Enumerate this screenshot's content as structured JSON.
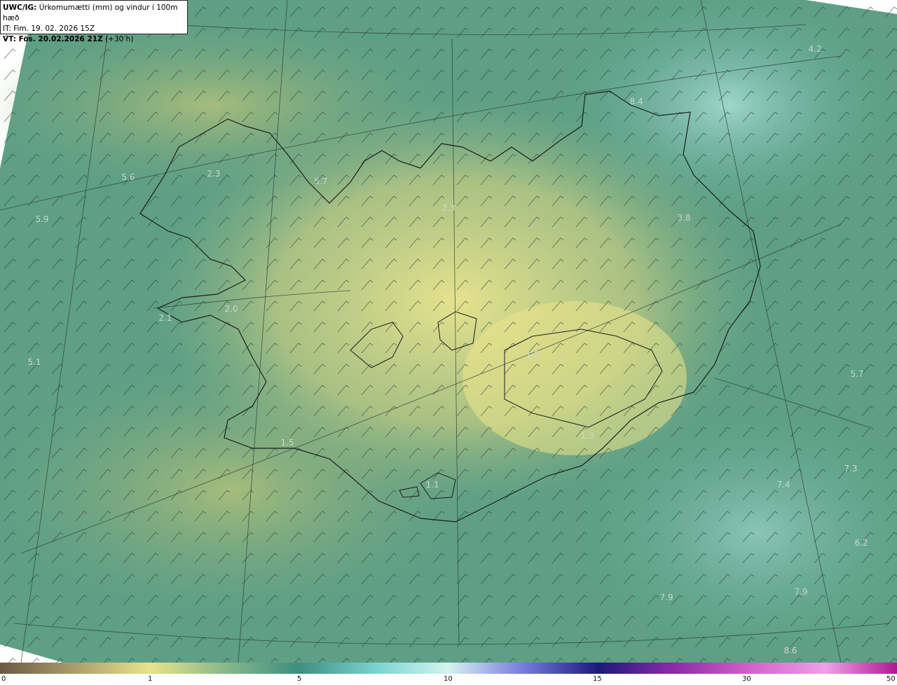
{
  "header": {
    "model_label": "UWC/IG:",
    "description": "Úrkomumætti (mm) og vindur í 100m hæð",
    "issue_time": "IT: Fim. 19. 02. 2026 15Z",
    "valid_label": "VT: Fös. 20.02.2026 21Z",
    "valid_offset": "(+30 h)"
  },
  "map_values": [
    "4.2",
    "8.4",
    "5.6",
    "2.3",
    "5.7",
    "5.9",
    "2.3",
    "3.8",
    "2.0",
    "2.1",
    "5.1",
    "1.5",
    "1.0",
    "5.7",
    "1.3",
    "7.3",
    "7.4",
    "1.1",
    "6.2",
    "7.9",
    "7.9",
    "8.6"
  ],
  "legend": {
    "ticks": [
      "0",
      "1",
      "5",
      "10",
      "15",
      "30",
      "50"
    ],
    "colors": [
      "#6b5a43",
      "#a99a6c",
      "#e9e38b",
      "#8ab88b",
      "#3f8e7f",
      "#7dd3d0",
      "#d6f3f0",
      "#7b7fe0",
      "#1a1a7a",
      "#8c2aa6",
      "#d060c8",
      "#f0a0e6"
    ]
  }
}
